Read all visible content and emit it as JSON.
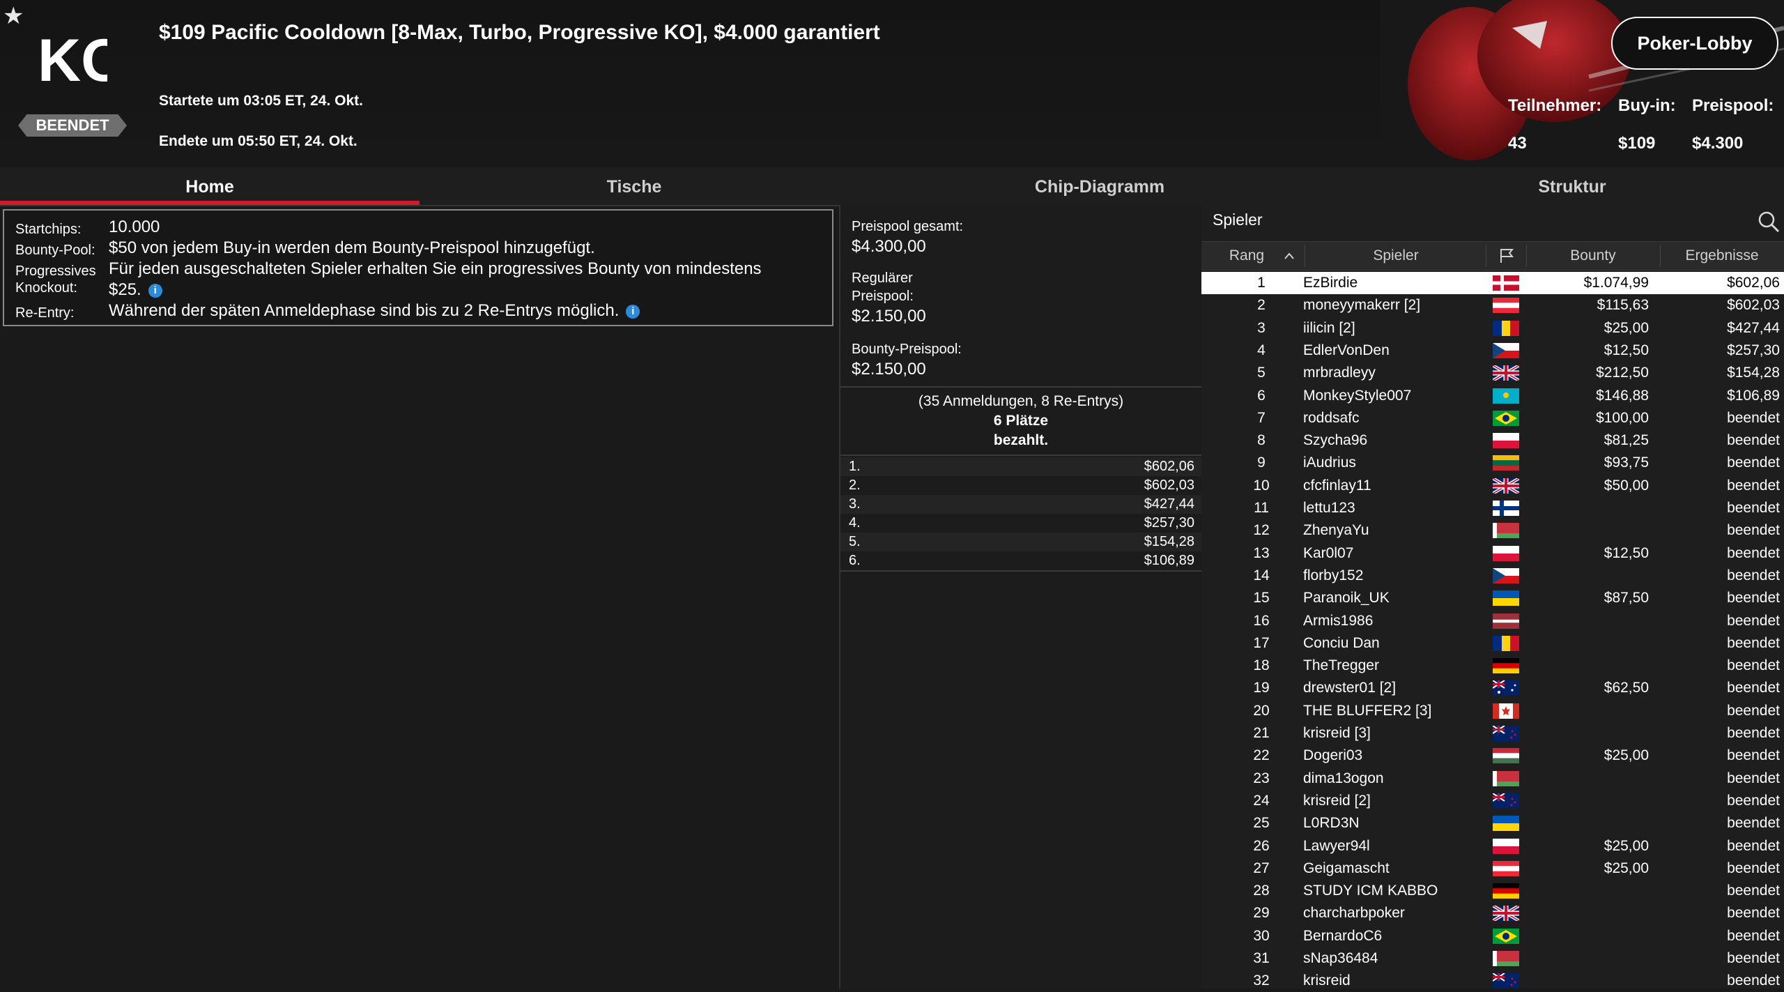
{
  "header": {
    "title": "$109 Pacific Cooldown [8-Max, Turbo, Progressive KO], $4.000 garantiert",
    "logo_text": "KO",
    "status": "BEENDET",
    "started": "Startete um 03:05 ET, 24. Okt.",
    "ended": "Endete um 05:50 ET, 24. Okt.",
    "lobby_button": "Poker-Lobby",
    "stats": {
      "participants_label": "Teilnehmer:",
      "participants_value": "43",
      "buyin_label": "Buy-in:",
      "buyin_value": "$109",
      "prizepool_label": "Preispool:",
      "prizepool_value": "$4.300"
    }
  },
  "tabs": [
    "Home",
    "Tische",
    "Chip-Diagramm",
    "Struktur"
  ],
  "info": {
    "startchips_label": "Startchips:",
    "startchips_value": "10.000",
    "bountypool_label": "Bounty-Pool:",
    "bountypool_value": "$50 von jedem Buy-in werden dem Bounty-Preispool hinzugefügt.",
    "progressive_label_1": "Progressives",
    "progressive_label_2": "Knockout:",
    "progressive_value_1": "Für jeden ausgeschalteten Spieler erhalten Sie ein progressives Bounty von mindestens",
    "progressive_value_2": "$25.",
    "reentry_label": "Re-Entry:",
    "reentry_value": "Während der späten Anmeldephase sind bis zu 2 Re-Entrys möglich.",
    "info_icon": "i"
  },
  "prizepool": {
    "total_label": "Preispool gesamt:",
    "total_value": "$4.300,00",
    "regular_label_1": "Regulärer",
    "regular_label_2": "Preispool:",
    "regular_value": "$2.150,00",
    "bounty_label": "Bounty-Preispool:",
    "bounty_value": "$2.150,00",
    "entries_note": "(35 Anmeldungen, 8 Re-Entrys)",
    "paid_line_1": "6 Plätze",
    "paid_line_2": "bezahlt.",
    "payouts": [
      {
        "place": "1.",
        "amount": "$602,06"
      },
      {
        "place": "2.",
        "amount": "$602,03"
      },
      {
        "place": "3.",
        "amount": "$427,44"
      },
      {
        "place": "4.",
        "amount": "$257,30"
      },
      {
        "place": "5.",
        "amount": "$154,28"
      },
      {
        "place": "6.",
        "amount": "$106,89"
      }
    ]
  },
  "players": {
    "title": "Spieler",
    "columns": {
      "rank": "Rang",
      "player": "Spieler",
      "bounty": "Bounty",
      "result": "Ergebnisse"
    },
    "rows": [
      {
        "rank": "1",
        "name": "EzBirdie",
        "flag": "dk",
        "bounty": "$1.074,99",
        "result": "$602,06"
      },
      {
        "rank": "2",
        "name": "moneyymakerr [2]",
        "flag": "at",
        "bounty": "$115,63",
        "result": "$602,03"
      },
      {
        "rank": "3",
        "name": "iilicin [2]",
        "flag": "ro",
        "bounty": "$25,00",
        "result": "$427,44"
      },
      {
        "rank": "4",
        "name": "EdlerVonDen",
        "flag": "cz",
        "bounty": "$12,50",
        "result": "$257,30"
      },
      {
        "rank": "5",
        "name": "mrbradleyy",
        "flag": "gb",
        "bounty": "$212,50",
        "result": "$154,28"
      },
      {
        "rank": "6",
        "name": "MonkeyStyle007",
        "flag": "kz",
        "bounty": "$146,88",
        "result": "$106,89"
      },
      {
        "rank": "7",
        "name": "roddsafc",
        "flag": "br",
        "bounty": "$100,00",
        "result": "beendet"
      },
      {
        "rank": "8",
        "name": "Szycha96",
        "flag": "pl",
        "bounty": "$81,25",
        "result": "beendet"
      },
      {
        "rank": "9",
        "name": "iAudrius",
        "flag": "lt",
        "bounty": "$93,75",
        "result": "beendet"
      },
      {
        "rank": "10",
        "name": "cfcfinlay11",
        "flag": "gb",
        "bounty": "$50,00",
        "result": "beendet"
      },
      {
        "rank": "11",
        "name": "lettu123",
        "flag": "fi",
        "bounty": "",
        "result": "beendet"
      },
      {
        "rank": "12",
        "name": "ZhenyaYu",
        "flag": "by",
        "bounty": "",
        "result": "beendet"
      },
      {
        "rank": "13",
        "name": "Kar0l07",
        "flag": "pl",
        "bounty": "$12,50",
        "result": "beendet"
      },
      {
        "rank": "14",
        "name": "florby152",
        "flag": "cz",
        "bounty": "",
        "result": "beendet"
      },
      {
        "rank": "15",
        "name": "Paranoik_UK",
        "flag": "ua",
        "bounty": "$87,50",
        "result": "beendet"
      },
      {
        "rank": "16",
        "name": "Armis1986",
        "flag": "lv",
        "bounty": "",
        "result": "beendet"
      },
      {
        "rank": "17",
        "name": "Conciu Dan",
        "flag": "ro",
        "bounty": "",
        "result": "beendet"
      },
      {
        "rank": "18",
        "name": "TheTregger",
        "flag": "de",
        "bounty": "",
        "result": "beendet"
      },
      {
        "rank": "19",
        "name": "drewster01 [2]",
        "flag": "au",
        "bounty": "$62,50",
        "result": "beendet"
      },
      {
        "rank": "20",
        "name": "THE BLUFFER2 [3]",
        "flag": "ca",
        "bounty": "",
        "result": "beendet"
      },
      {
        "rank": "21",
        "name": "krisreid [3]",
        "flag": "nz",
        "bounty": "",
        "result": "beendet"
      },
      {
        "rank": "22",
        "name": "Dogeri03",
        "flag": "hu",
        "bounty": "$25,00",
        "result": "beendet"
      },
      {
        "rank": "23",
        "name": "dima13ogon",
        "flag": "by",
        "bounty": "",
        "result": "beendet"
      },
      {
        "rank": "24",
        "name": "krisreid [2]",
        "flag": "nz",
        "bounty": "",
        "result": "beendet"
      },
      {
        "rank": "25",
        "name": "L0RD3N",
        "flag": "ua",
        "bounty": "",
        "result": "beendet"
      },
      {
        "rank": "26",
        "name": "Lawyer94l",
        "flag": "pl",
        "bounty": "$25,00",
        "result": "beendet"
      },
      {
        "rank": "27",
        "name": "Geigamascht",
        "flag": "at",
        "bounty": "$25,00",
        "result": "beendet"
      },
      {
        "rank": "28",
        "name": "STUDY ICM KABBO",
        "flag": "de",
        "bounty": "",
        "result": "beendet"
      },
      {
        "rank": "29",
        "name": "charcharbpoker",
        "flag": "gb",
        "bounty": "",
        "result": "beendet"
      },
      {
        "rank": "30",
        "name": "BernardoC6",
        "flag": "br",
        "bounty": "",
        "result": "beendet"
      },
      {
        "rank": "31",
        "name": "sNap36484",
        "flag": "by",
        "bounty": "",
        "result": "beendet"
      },
      {
        "rank": "32",
        "name": "krisreid",
        "flag": "nz",
        "bounty": "",
        "result": "beendet"
      }
    ]
  },
  "colors": {
    "accent": "#d11a2a",
    "info_icon": "#2d8ad8",
    "badge": "#6e6e6e"
  }
}
